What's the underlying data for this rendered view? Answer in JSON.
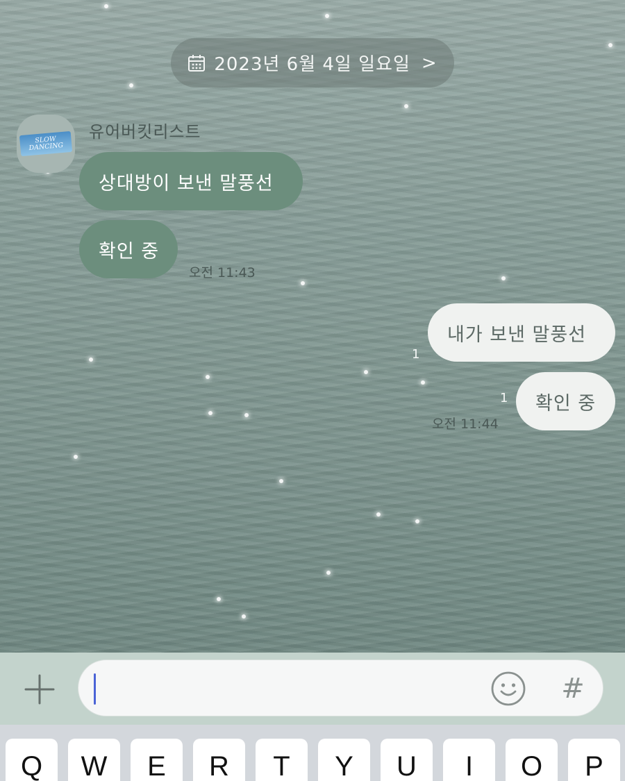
{
  "chat": {
    "date_label": "2023년 6월 4일 일요일",
    "date_chevron": ">",
    "sender_name": "유어버킷리스트",
    "avatar_logo_text": "SLOW\nDANCING",
    "received": [
      {
        "text": "상대방이 보낸 말풍선"
      },
      {
        "text": "확인 중"
      }
    ],
    "received_time": "오전 11:43",
    "sent": [
      {
        "text": "내가 보낸 말풍선",
        "unread": "1"
      },
      {
        "text": "확인 중",
        "unread": "1"
      }
    ],
    "sent_time": "오전 11:44"
  },
  "input_bar": {
    "message_value": "",
    "hash_label": "#",
    "icons": [
      "plus-icon",
      "smile-icon",
      "calendar-icon"
    ]
  },
  "keyboard": {
    "row1": [
      "Q",
      "W",
      "E",
      "R",
      "T",
      "Y",
      "U",
      "I",
      "O",
      "P"
    ]
  },
  "colors": {
    "received_bubble": "#6c8e7d",
    "sent_bubble": "#f0f2f0",
    "input_bar": "#c3d3cc",
    "cursor": "#4a63d6"
  }
}
